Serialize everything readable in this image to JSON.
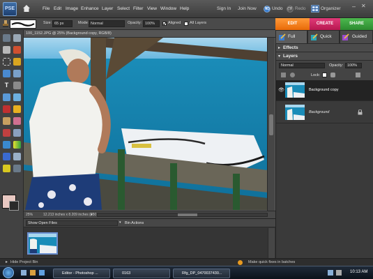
{
  "menubar": {
    "logo_text": "PSE",
    "items": [
      "File",
      "Edit",
      "Image",
      "Enhance",
      "Layer",
      "Select",
      "Filter",
      "View",
      "Window",
      "Help"
    ],
    "sign_in": "Sign In",
    "join_now": "Join Now",
    "undo": "Undo",
    "redo": "Redo",
    "organizer": "Organizer"
  },
  "options": {
    "size_label": "Size:",
    "size_value": "65 px",
    "mode_label": "Mode:",
    "mode_value": "Normal",
    "opacity_label": "Opacity:",
    "opacity_value": "100%",
    "aligned": "Aligned",
    "all_layers": "All Layers"
  },
  "tabs": {
    "edit": "EDIT",
    "create": "CREATE",
    "share": "SHARE"
  },
  "subtabs": {
    "full": "Full",
    "quick": "Quick",
    "guided": "Guided"
  },
  "document": {
    "title": "100_1152.JPG @ 25% (Background copy, RGB/8)",
    "zoom": "25%",
    "dimensions": "12.213 inches x 8.209 inches (250 ppi)"
  },
  "bin": {
    "show_label": "Show Open Files",
    "actions_label": "Bin Actions",
    "hide_label": "Hide Project Bin"
  },
  "panels": {
    "effects": "Effects",
    "layers": "Layers",
    "blend_mode": "Normal",
    "opacity_label": "Opacity:",
    "opacity_value": "100%",
    "lock_label": "Lock:",
    "layers_list": [
      {
        "name": "Background copy"
      },
      {
        "name": "Background"
      }
    ]
  },
  "status": {
    "tip": "Make quick fixes in batches"
  },
  "taskbar": {
    "items": [
      "Editor - Photoshop ...",
      "0163",
      "Rfg_DP_0470037430..."
    ],
    "clock": "10:13 AM"
  },
  "colors": {
    "edit_tab": "#f0760d",
    "create_tab": "#c81f5b",
    "share_tab": "#3a9a3c",
    "selected_layer": "#2b2b2b",
    "foreground": "#2a2a2a",
    "background": "#e8c8c2"
  }
}
